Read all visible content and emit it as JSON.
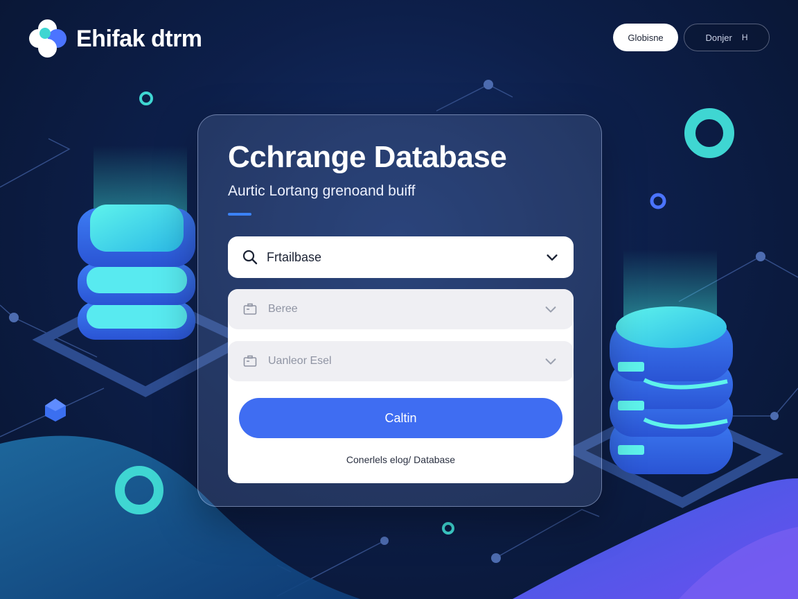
{
  "brand": {
    "name": "Ehifak dtrm",
    "logo_icon": "four-petal-logo-icon"
  },
  "header": {
    "primary_button": "Globisne",
    "outline_button": "Donjer",
    "outline_suffix": "H"
  },
  "card": {
    "title": "Cchrange Database",
    "subtitle": "Aurtic Lortang grenoand buiff",
    "search": {
      "value": "Frtailbase",
      "icon": "search-icon",
      "chevron": "chevron-down-icon"
    },
    "fields": [
      {
        "placeholder": "Beree",
        "icon": "briefcase-icon",
        "chevron": "chevron-down-icon"
      },
      {
        "placeholder": "Uanleor Esel",
        "icon": "briefcase-icon",
        "chevron": "chevron-down-icon"
      }
    ],
    "submit_label": "Caltin",
    "footer_link": "Conerlels elog/ Database"
  },
  "colors": {
    "accent": "#3f6df2",
    "teal": "#3fd6d2",
    "background": "#0d1f4a"
  }
}
